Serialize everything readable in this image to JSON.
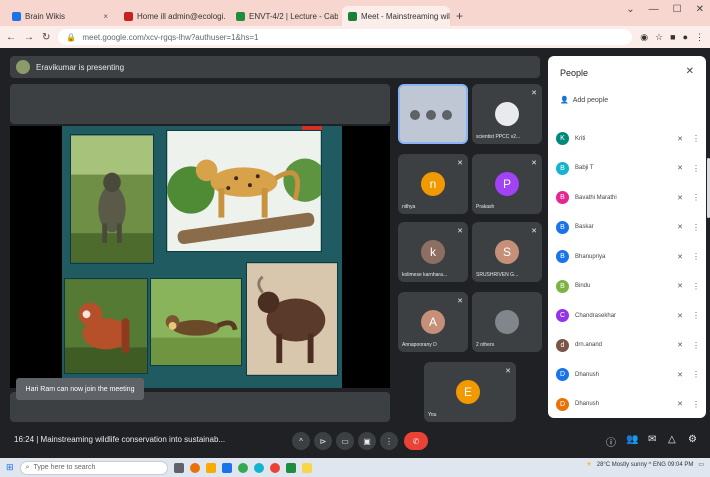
{
  "browser": {
    "tabs": [
      {
        "label": "Brain Wikis",
        "color": "#1a73e8"
      },
      {
        "label": "Home ill  admin@ecologi...",
        "color": "#c5221f"
      },
      {
        "label": "ENVT-4/2 | Lecture - Cabin",
        "color": "#1e8e3e"
      },
      {
        "label": "Meet - Mainstreaming wildli...",
        "color": "#188038"
      }
    ],
    "new_tab": "+",
    "url": "meet.google.com/xcv-rgqs-lhw?authuser=1&hs=1",
    "window_controls": [
      "⌄",
      "—",
      "☐",
      "✕"
    ]
  },
  "meet": {
    "presenting_banner": "Eravikumar is presenting",
    "toast": "Hari Ram can now join the meeting",
    "tiles": [
      {
        "name": "",
        "initial": "",
        "color": "#bfc7d5",
        "self": true
      },
      {
        "name": "scientist PPCC v2...",
        "initial": "",
        "color": "#e8eaed"
      },
      {
        "name": "nithya",
        "initial": "n",
        "color": "#f29900"
      },
      {
        "name": "Prakash",
        "initial": "P",
        "color": "#a142f4"
      },
      {
        "name": "kolimese karnhara...",
        "initial": "k",
        "color": "#8d6e63"
      },
      {
        "name": "SRUSHRIVEN G...",
        "initial": "S",
        "color": "#c58f7a"
      },
      {
        "name": "Annapoorany D",
        "initial": "A",
        "color": "#c58f7a"
      },
      {
        "name": "2 others",
        "initial": "",
        "color": "#80868b"
      },
      {
        "name": "You",
        "initial": "E",
        "color": "#f29900"
      }
    ],
    "people_panel": {
      "title": "People",
      "close": "✕",
      "add_people": "Add people",
      "participants": [
        {
          "name": "Kriti",
          "initial": "K",
          "color": "#00897b"
        },
        {
          "name": "Babji T",
          "initial": "B",
          "color": "#12b5cb"
        },
        {
          "name": "Bavathi Marathi",
          "initial": "B",
          "color": "#e52592"
        },
        {
          "name": "Baskar",
          "initial": "B",
          "color": "#1a73e8"
        },
        {
          "name": "Bhanupriya",
          "initial": "B",
          "color": "#1a73e8"
        },
        {
          "name": "Bindu",
          "initial": "B",
          "color": "#7cb342"
        },
        {
          "name": "Chandrasekhar",
          "initial": "C",
          "color": "#9334e6"
        },
        {
          "name": "drn.anand",
          "initial": "d",
          "color": "#795548"
        },
        {
          "name": "Dhanush",
          "initial": "D",
          "color": "#1a73e8"
        },
        {
          "name": "Dhanush",
          "initial": "D",
          "color": "#e8710a"
        }
      ]
    },
    "meeting_info": "16:24  |  Mainstreaming wildlife conservation into sustainab...",
    "controls": [
      "^",
      "⊳",
      "▭",
      "▣",
      "⋮",
      "✆"
    ],
    "right_controls": [
      "ⓘ",
      "👥",
      "✉",
      "△",
      "⚙"
    ]
  },
  "taskbar": {
    "search_placeholder": "Type here to search",
    "tray_text": "28°C  Mostly sunny  ^  ENG  09:04 PM"
  }
}
